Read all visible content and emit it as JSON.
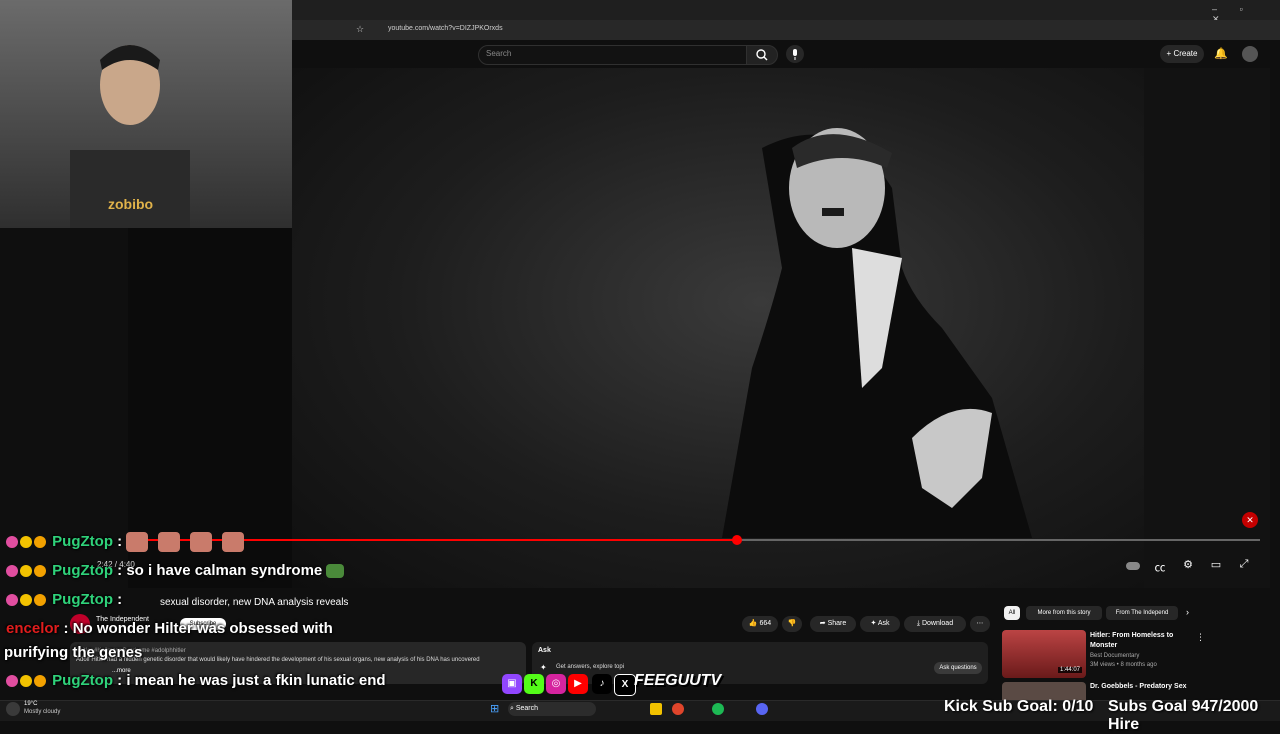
{
  "browser": {
    "url": "youtube.com/watch?v=DIZJPKOrxds",
    "window_controls": "– ▫ ✕"
  },
  "youtube": {
    "search_placeholder": "Search",
    "create_label": "Create"
  },
  "player": {
    "time": "2:42 / 4:40",
    "progress_fraction": 0.538
  },
  "video_info": {
    "title": "sexual disorder, new DNA analysis reveals",
    "channel": "The Independent",
    "subscribe_label": "Subscribe",
    "like_count": "664",
    "share_label": "Share",
    "ask_label": "Ask",
    "download_label": "Download",
    "tags": "#hitler #KallmannSyndrome #adolphhitler",
    "description": "Adolf Hitler had a hidden genetic disorder that would likely have hindered the development of his sexual organs, new analysis of his DNA has uncovered",
    "more_label": "...more"
  },
  "ask_panel": {
    "title": "Ask",
    "prompt": "Get answers, explore topi",
    "button": "Ask questions"
  },
  "sidebar": {
    "chips": [
      "All",
      "More from this story",
      "From The Independ"
    ],
    "recommendations": [
      {
        "title": "Hitler: From Homeless to Monster",
        "channel": "Best Documentary",
        "meta": "3M views • 8 months ago",
        "duration": "1:44:07"
      },
      {
        "title": "Dr. Goebbels - Predatory Sex"
      }
    ]
  },
  "chat": [
    {
      "user": "PugZtop",
      "message": ""
    },
    {
      "user": "PugZtop",
      "message": "so i have calman syndrome"
    },
    {
      "user": "PugZtop",
      "message": ""
    },
    {
      "user": "encelor",
      "message": "No wonder Hilter was obsessed with"
    },
    {
      "user": "",
      "message": "purifying the genes"
    },
    {
      "user": "PugZtop",
      "message": "i mean he was just a fkin lunatic end"
    }
  ],
  "overlay": {
    "brand": "FEEGUUTV",
    "kick_goal": "Kick Sub Goal: 0/10",
    "subs_goal": "Subs Goal 947/2000 Hire",
    "shirt_text": "zobibo"
  },
  "taskbar": {
    "temp": "19°C",
    "weather": "Mostly cloudy",
    "search": "Search"
  }
}
